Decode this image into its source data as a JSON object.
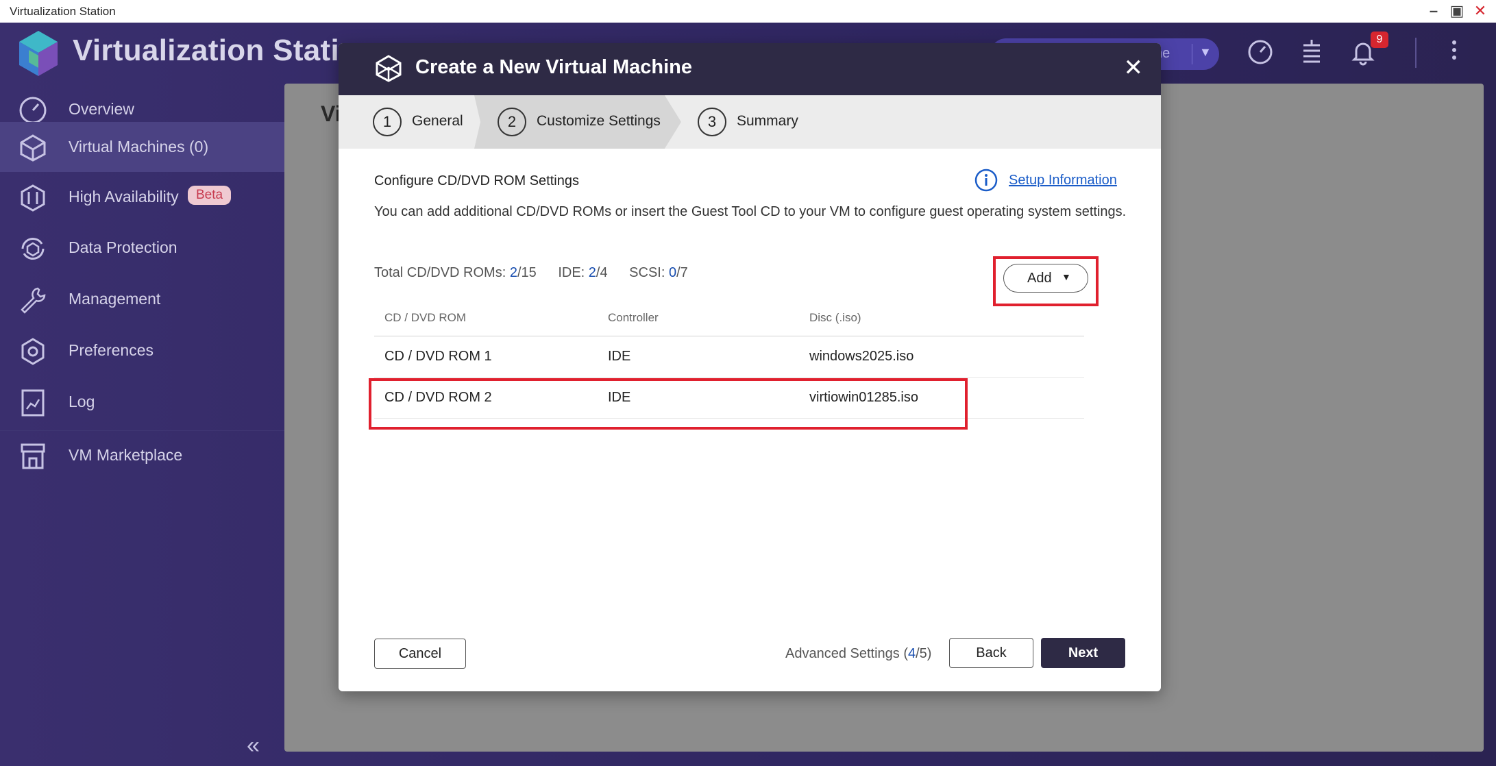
{
  "os": {
    "title": "Virtualization Station"
  },
  "app": {
    "title": "Virtualization Station",
    "chip_text": "ne",
    "notification_count": "9"
  },
  "sidebar": {
    "items": [
      {
        "label": "Overview",
        "icon": "gauge-icon"
      },
      {
        "label": "Virtual Machines (0)",
        "icon": "vm-cube-icon"
      },
      {
        "label": "High Availability",
        "icon": "high-availability-icon",
        "badge": "Beta"
      },
      {
        "label": "Data Protection",
        "icon": "data-protection-icon"
      },
      {
        "label": "Management",
        "icon": "wrench-icon"
      },
      {
        "label": "Preferences",
        "icon": "gear-icon"
      },
      {
        "label": "Log",
        "icon": "log-icon"
      },
      {
        "label": "VM Marketplace",
        "icon": "marketplace-icon"
      }
    ],
    "active_index": 1
  },
  "main": {
    "peek_title": "Vi"
  },
  "modal": {
    "title": "Create a New Virtual Machine",
    "steps": [
      {
        "num": "1",
        "label": "General"
      },
      {
        "num": "2",
        "label": "Customize Settings"
      },
      {
        "num": "3",
        "label": "Summary"
      }
    ],
    "active_step": 2,
    "section_title": "Configure CD/DVD ROM Settings",
    "setup_link": "Setup Information",
    "description": "You can add additional CD/DVD ROMs or insert the Guest Tool CD to your VM to configure guest operating system settings.",
    "counts": {
      "total_label": "Total CD/DVD ROMs:",
      "total_used": "2",
      "total_max": "/15",
      "ide_label": "IDE:",
      "ide_used": "2",
      "ide_max": "/4",
      "scsi_label": "SCSI:",
      "scsi_used": "0",
      "scsi_max": "/7"
    },
    "add_button": "Add",
    "table": {
      "headers": [
        "CD / DVD ROM",
        "Controller",
        "Disc (.iso)"
      ],
      "rows": [
        [
          "CD / DVD ROM 1",
          "IDE",
          "windows2025.iso"
        ],
        [
          "CD / DVD ROM 2",
          "IDE",
          "virtiowin01285.iso"
        ]
      ]
    },
    "footer": {
      "cancel": "Cancel",
      "adv_prefix": "Advanced Settings (",
      "adv_current": "4",
      "adv_suffix": "/5)",
      "back": "Back",
      "next": "Next"
    }
  },
  "colors": {
    "highlight": "#e0202e",
    "accent_dark": "#2e2a45",
    "link": "#1a5cc8",
    "sidebar_bg": "#2f2660"
  }
}
